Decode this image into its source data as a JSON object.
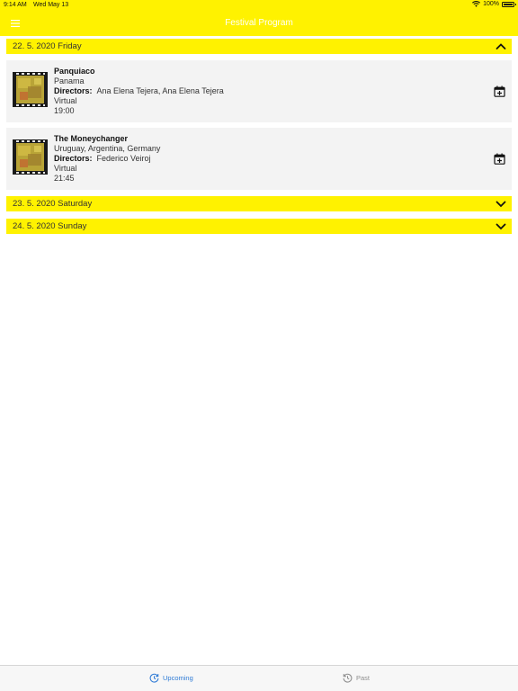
{
  "status_bar": {
    "time": "9:14 AM",
    "date": "Wed May 13",
    "battery_text": "100%",
    "battery_level": 1.0,
    "icons": [
      "wifi-icon",
      "battery-icon"
    ]
  },
  "nav": {
    "title": "Festival Program",
    "menu_icon": "hamburger-menu-icon"
  },
  "sections": [
    {
      "label": "22. 5. 2020 Friday",
      "expanded": true,
      "films": [
        {
          "title": "Panquiaco",
          "country": "Panama",
          "directors_label": "Directors:",
          "directors": "Ana Elena Tejera, Ana Elena Tejera",
          "venue": "Virtual",
          "time": "19:00"
        },
        {
          "title": "The Moneychanger",
          "country": "Uruguay, Argentina, Germany",
          "directors_label": "Directors:",
          "directors": "Federico Veiroj",
          "venue": "Virtual",
          "time": "21:45"
        }
      ]
    },
    {
      "label": "23. 5. 2020 Saturday",
      "expanded": false,
      "films": []
    },
    {
      "label": "24. 5. 2020 Sunday",
      "expanded": false,
      "films": []
    }
  ],
  "tabs": [
    {
      "label": "Upcoming",
      "icon": "refresh-clock-icon",
      "active": true
    },
    {
      "label": "Past",
      "icon": "history-icon",
      "active": false
    }
  ],
  "colors": {
    "accent_yellow": "#fff200",
    "active_tab": "#2f7bd6",
    "inactive_tab": "#8e8e8e",
    "card_bg": "#f3f3f3"
  }
}
